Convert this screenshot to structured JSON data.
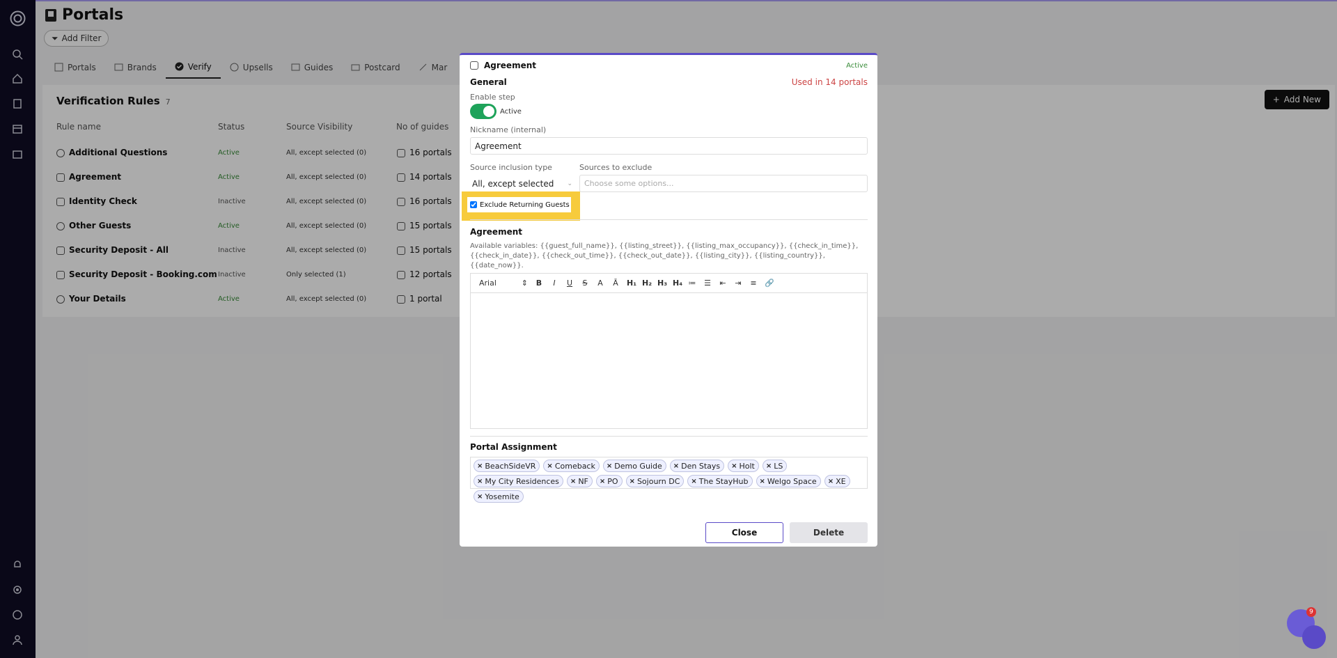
{
  "page": {
    "title": "Portals",
    "add_filter": "Add Filter"
  },
  "tabs": [
    "Portals",
    "Brands",
    "Verify",
    "Upsells",
    "Guides",
    "Postcard",
    "Mar"
  ],
  "card": {
    "title": "Verification Rules",
    "count": "7",
    "add_new": "Add New",
    "headers": {
      "name": "Rule name",
      "status": "Status",
      "visibility": "Source Visibility",
      "guides": "No of guides"
    },
    "rows": [
      {
        "name": "Additional Questions",
        "status": "Active",
        "visibility": "All, except selected (0)",
        "guides": "16 portals"
      },
      {
        "name": "Agreement",
        "status": "Active",
        "visibility": "All, except selected (0)",
        "guides": "14 portals"
      },
      {
        "name": "Identity Check",
        "status": "Inactive",
        "visibility": "All, except selected (0)",
        "guides": "16 portals"
      },
      {
        "name": "Other Guests",
        "status": "Active",
        "visibility": "All, except selected (0)",
        "guides": "15 portals"
      },
      {
        "name": "Security Deposit - All",
        "status": "Inactive",
        "visibility": "All, except selected (0)",
        "guides": "15 portals"
      },
      {
        "name": "Security Deposit - Booking.com",
        "status": "Inactive",
        "visibility": "Only selected (1)",
        "guides": "12 portals"
      },
      {
        "name": "Your Details",
        "status": "Active",
        "visibility": "All, except selected (0)",
        "guides": "1 portal"
      }
    ]
  },
  "modal": {
    "title": "Agreement",
    "state": "Active",
    "general": "General",
    "used_in": "Used in 14 portals",
    "enable_step_label": "Enable step",
    "toggle_text": "Active",
    "nickname_label": "Nickname (internal)",
    "nickname_value": "Agreement",
    "source_type_label": "Source inclusion type",
    "source_type_value": "All, except selected",
    "sources_exclude_label": "Sources to exclude",
    "sources_exclude_placeholder": "Choose some options...",
    "exclude_returning": "Exclude Returning Guests",
    "agreement_heading": "Agreement",
    "variables": "Available variables: {{guest_full_name}}, {{listing_street}}, {{listing_max_occupancy}}, {{check_in_time}}, {{check_in_date}}, {{check_out_time}}, {{check_out_date}}, {{listing_city}}, {{listing_country}}, {{date_now}}.",
    "font": "Arial",
    "portal_assignment": "Portal Assignment",
    "portals": [
      "BeachSideVR",
      "Comeback",
      "Demo Guide",
      "Den Stays",
      "Holt",
      "LS",
      "My City Residences",
      "NF",
      "PO",
      "Sojourn DC",
      "The StayHub",
      "Welgo Space",
      "XE",
      "Yosemite"
    ],
    "close": "Close",
    "delete": "Delete"
  },
  "chat_badge": "9"
}
